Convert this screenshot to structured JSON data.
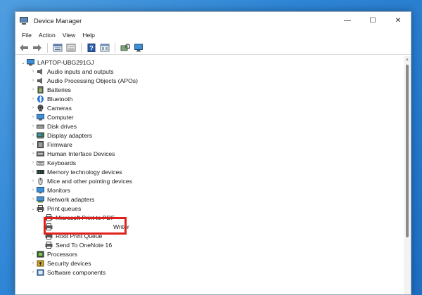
{
  "window": {
    "title": "Device Manager",
    "controls": {
      "minimize": "—",
      "maximize": "☐",
      "close": "✕"
    }
  },
  "menu": [
    "File",
    "Action",
    "View",
    "Help"
  ],
  "toolbar": {
    "buttons": [
      "back-icon",
      "forward-icon",
      "properties-icon",
      "show-hide-icon",
      "help-icon",
      "view-icon",
      "scan-hardware-icon",
      "monitor-icon"
    ]
  },
  "tree": {
    "root": "LAPTOP-UBG291GJ",
    "categories": [
      {
        "label": "Audio inputs and outputs",
        "icon": "audio-icon"
      },
      {
        "label": "Audio Processing Objects (APOs)",
        "icon": "audio-icon"
      },
      {
        "label": "Batteries",
        "icon": "battery-icon"
      },
      {
        "label": "Bluetooth",
        "icon": "bluetooth-icon"
      },
      {
        "label": "Cameras",
        "icon": "camera-icon"
      },
      {
        "label": "Computer",
        "icon": "computer-icon"
      },
      {
        "label": "Disk drives",
        "icon": "disk-icon"
      },
      {
        "label": "Display adapters",
        "icon": "display-adapter-icon"
      },
      {
        "label": "Firmware",
        "icon": "firmware-icon"
      },
      {
        "label": "Human Interface Devices",
        "icon": "hid-icon"
      },
      {
        "label": "Keyboards",
        "icon": "keyboard-icon"
      },
      {
        "label": "Memory technology devices",
        "icon": "memory-icon"
      },
      {
        "label": "Mice and other pointing devices",
        "icon": "mouse-icon"
      },
      {
        "label": "Monitors",
        "icon": "monitor-icon"
      },
      {
        "label": "Network adapters",
        "icon": "network-icon"
      },
      {
        "label": "Print queues",
        "icon": "printer-icon",
        "expanded": true
      }
    ],
    "print_queue_children": [
      {
        "label": "Microsoft Print to PDF"
      },
      {
        "label": "Writer"
      },
      {
        "label": "Root Print Queue"
      },
      {
        "label": "Send To OneNote 16"
      }
    ],
    "after_categories": [
      {
        "label": "Processors",
        "icon": "processor-icon"
      },
      {
        "label": "Security devices",
        "icon": "security-icon"
      },
      {
        "label": "Software components",
        "icon": "software-icon"
      }
    ]
  },
  "colors": {
    "highlight": "#e0201d",
    "desktop": "#2f86d6"
  }
}
